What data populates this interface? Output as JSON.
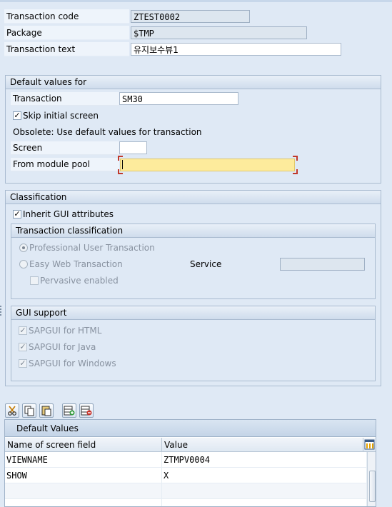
{
  "header": {
    "transaction_code_label": "Transaction code",
    "transaction_code_value": "ZTEST0002",
    "package_label": "Package",
    "package_value": "$TMP",
    "transaction_text_label": "Transaction text",
    "transaction_text_value": "유지보수뷰1"
  },
  "defaults": {
    "title": "Default values for",
    "transaction_label": "Transaction",
    "transaction_value": "SM30",
    "skip_label": "Skip initial screen",
    "skip_checked": "✓",
    "obsolete_text": "Obsolete: Use default values for transaction",
    "screen_label": "Screen",
    "screen_value": "",
    "module_pool_label": "From module pool",
    "module_pool_value": ""
  },
  "classification": {
    "title": "Classification",
    "inherit_label": "Inherit GUI attributes",
    "inherit_checked": "✓",
    "tx_class": {
      "title": "Transaction classification",
      "professional_label": "Professional User Transaction",
      "easy_web_label": "Easy Web Transaction",
      "service_label": "Service",
      "service_value": "",
      "pervasive_label": "Pervasive enabled"
    },
    "gui_support": {
      "title": "GUI support",
      "html_label": "SAPGUI for HTML",
      "java_label": "SAPGUI for Java",
      "windows_label": "SAPGUI for Windows",
      "check": "✓"
    }
  },
  "toolbar": {
    "icons": [
      "cut-icon",
      "copy-icon",
      "paste-icon",
      "insert-row-icon",
      "delete-row-icon"
    ]
  },
  "default_values_table": {
    "title": "Default Values",
    "columns": [
      "Name of screen field",
      "Value"
    ],
    "rows": [
      {
        "name": "VIEWNAME",
        "value": "ZTMPV0004"
      },
      {
        "name": "SHOW",
        "value": "X"
      }
    ]
  },
  "colors": {
    "background": "#dfe9f5",
    "focus_field": "#fdeb9c",
    "focus_marker": "#c0392b"
  }
}
